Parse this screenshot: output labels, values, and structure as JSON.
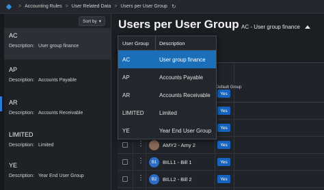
{
  "breadcrumb": {
    "items": [
      "Accounting Rules",
      "User Related Data",
      "Users per User Group"
    ],
    "separator": ">"
  },
  "sort": {
    "label": "Sort by",
    "icon": "chevron-down-icon"
  },
  "groups": [
    {
      "code": "AC",
      "desc_label": "Description:",
      "desc": "User group finance"
    },
    {
      "code": "AP",
      "desc_label": "Description:",
      "desc": "Accounts Payable"
    },
    {
      "code": "AR",
      "desc_label": "Description:",
      "desc": "Accounts Receivable"
    },
    {
      "code": "LIMITED",
      "desc_label": "Description:",
      "desc": "Limited"
    },
    {
      "code": "YE",
      "desc_label": "Description:",
      "desc": "Year End User Group"
    }
  ],
  "page": {
    "title": "Users per User Group",
    "selected_group": "AC - User group finance"
  },
  "dropdown": {
    "headers": [
      "User Group",
      "Description"
    ],
    "rows": [
      {
        "code": "AC",
        "desc": "User group finance"
      },
      {
        "code": "AP",
        "desc": "Accounts Payable"
      },
      {
        "code": "AR",
        "desc": "Accounts Receivable"
      },
      {
        "code": "LIMITED",
        "desc": "Limited"
      },
      {
        "code": "YE",
        "desc": "Year End User Group"
      }
    ]
  },
  "table": {
    "default_header": "Default Group",
    "rows": [
      {
        "avatar": "",
        "user": "",
        "default": "Yes"
      },
      {
        "avatar": "",
        "user": "",
        "default": "Yes"
      },
      {
        "avatar": "",
        "user": "",
        "default": "Yes"
      },
      {
        "avatar": "AMY",
        "user": "AMY2 - Amy 2",
        "default": "Yes"
      },
      {
        "avatar": "B1",
        "user": "BILL1 - Bill 1",
        "default": "Yes"
      },
      {
        "avatar": "B2",
        "user": "BILL2 - Bill 2",
        "default": "Yes"
      }
    ]
  },
  "colors": {
    "accent": "#1a6fb8",
    "yes_badge": "#1565c0",
    "avatar": "#2d6cc6"
  }
}
